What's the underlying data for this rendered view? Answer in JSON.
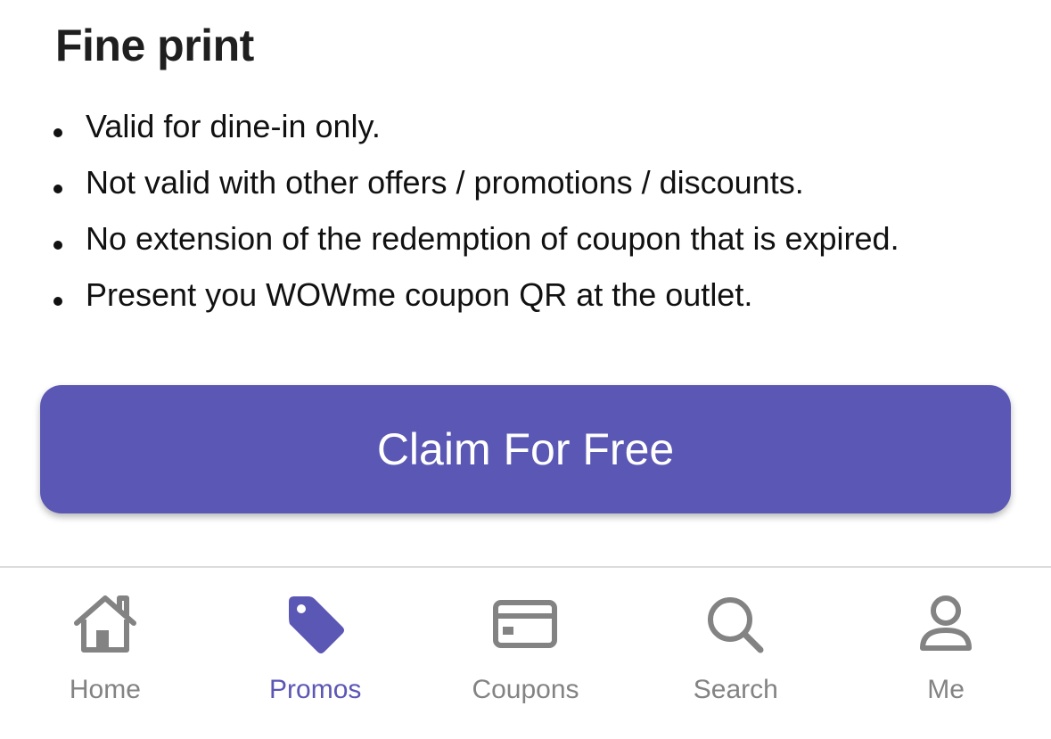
{
  "fine_print": {
    "title": "Fine print",
    "items": [
      "Valid for dine-in only.",
      "Not valid with other offers / promotions / discounts.",
      "No extension of the redemption of coupon that is expired.",
      "Present you WOWme coupon QR at the outlet."
    ]
  },
  "claim_button": {
    "label": "Claim For Free"
  },
  "bottom_nav": {
    "items": [
      {
        "label": "Home",
        "icon": "home-icon",
        "active": false
      },
      {
        "label": "Promos",
        "icon": "tag-icon",
        "active": true
      },
      {
        "label": "Coupons",
        "icon": "card-icon",
        "active": false
      },
      {
        "label": "Search",
        "icon": "search-icon",
        "active": false
      },
      {
        "label": "Me",
        "icon": "person-icon",
        "active": false
      }
    ]
  },
  "colors": {
    "accent": "#5b57b4",
    "inactive": "#838383",
    "text": "#111111"
  }
}
